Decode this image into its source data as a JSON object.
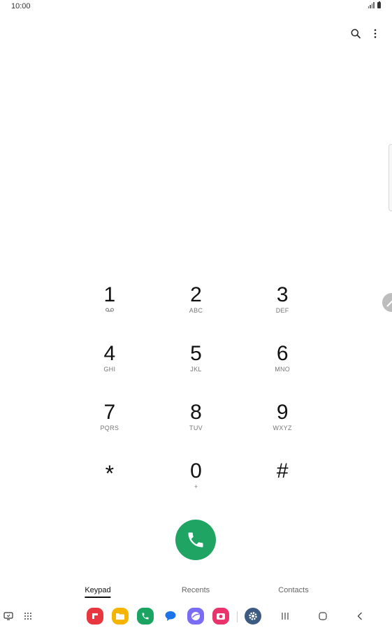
{
  "status_bar": {
    "time": "10:00"
  },
  "keypad": {
    "keys": [
      {
        "digit": "1",
        "sub": ""
      },
      {
        "digit": "2",
        "sub": "ABC"
      },
      {
        "digit": "3",
        "sub": "DEF"
      },
      {
        "digit": "4",
        "sub": "GHI"
      },
      {
        "digit": "5",
        "sub": "JKL"
      },
      {
        "digit": "6",
        "sub": "MNO"
      },
      {
        "digit": "7",
        "sub": "PQRS"
      },
      {
        "digit": "8",
        "sub": "TUV"
      },
      {
        "digit": "9",
        "sub": "WXYZ"
      },
      {
        "digit": "*",
        "sub": ""
      },
      {
        "digit": "0",
        "sub": "+"
      },
      {
        "digit": "#",
        "sub": ""
      }
    ]
  },
  "tabs": [
    {
      "label": "Keypad",
      "active": true
    },
    {
      "label": "Recents",
      "active": false
    },
    {
      "label": "Contacts",
      "active": false
    }
  ],
  "colors": {
    "call_green": "#1fa463",
    "apps": [
      "#e8373e",
      "#f4b400",
      "#1ba361",
      "#1a73e8",
      "#7b6cf6",
      "#e8336b",
      "#3d5a80"
    ]
  },
  "icons": {
    "search": "search-icon",
    "more": "more-vertical-icon",
    "call": "phone-icon",
    "edit": "pencil-icon"
  }
}
